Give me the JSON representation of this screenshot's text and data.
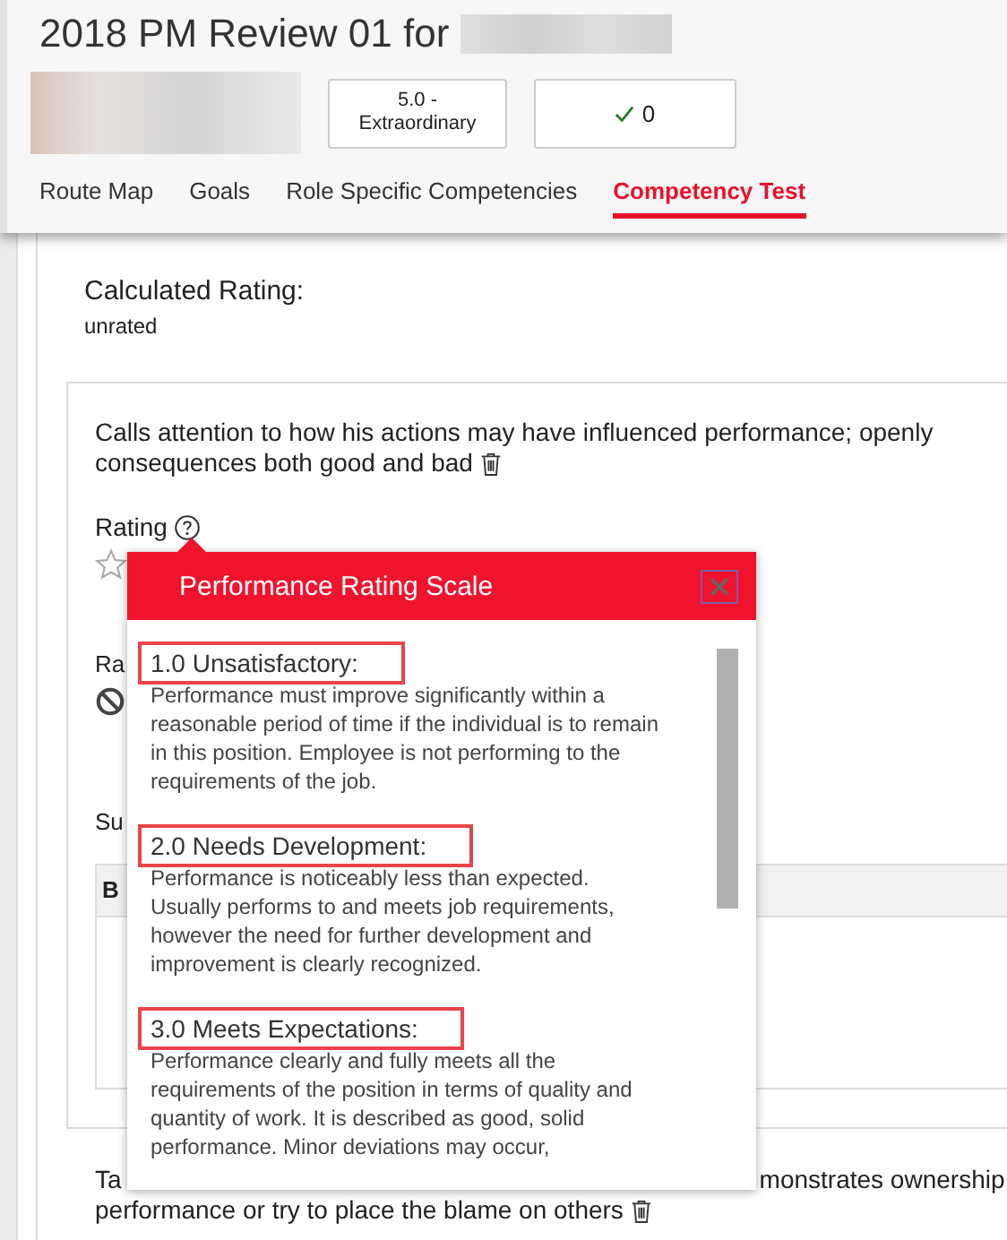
{
  "header": {
    "title": "2018 PM Review 01 for",
    "rating_badge": "5.0 - Extraordinary",
    "check_count": "0"
  },
  "tabs": [
    {
      "label": "Route Map",
      "selected": false
    },
    {
      "label": "Goals",
      "selected": false
    },
    {
      "label": "Role Specific Competencies",
      "selected": false
    },
    {
      "label": "Competency Test",
      "selected": true
    }
  ],
  "calculated_rating": {
    "label": "Calculated Rating:",
    "value": "unrated"
  },
  "competency": {
    "description": [
      "Calls attention to how his actions may have influenced performance; openly",
      "consequences both good and bad"
    ],
    "rating_label": "Rating",
    "second_label": "Ra",
    "section_label": "Su",
    "table_header": "B"
  },
  "next_competency": {
    "line_start": "Ta",
    "line_end": "monstrates ownership",
    "line_2": "performance or try to place the blame on others"
  },
  "popover": {
    "title": "Performance Rating Scale",
    "levels": [
      {
        "label": "1.0 Unsatisfactory:",
        "description": "Performance must improve significantly within a reasonable period of time if the individual is to remain in this position. Employee is not performing to the requirements of the job."
      },
      {
        "label": "2.0 Needs Development:",
        "description": "Performance is noticeably less than expected. Usually performs to and meets job requirements, however the need for further development and improvement is clearly recognized."
      },
      {
        "label": "3.0 Meets Expectations:",
        "description": "Performance clearly and fully meets all the requirements of the position in terms of quality and quantity of work. It is described as good, solid performance. Minor deviations may occur,"
      }
    ]
  }
}
